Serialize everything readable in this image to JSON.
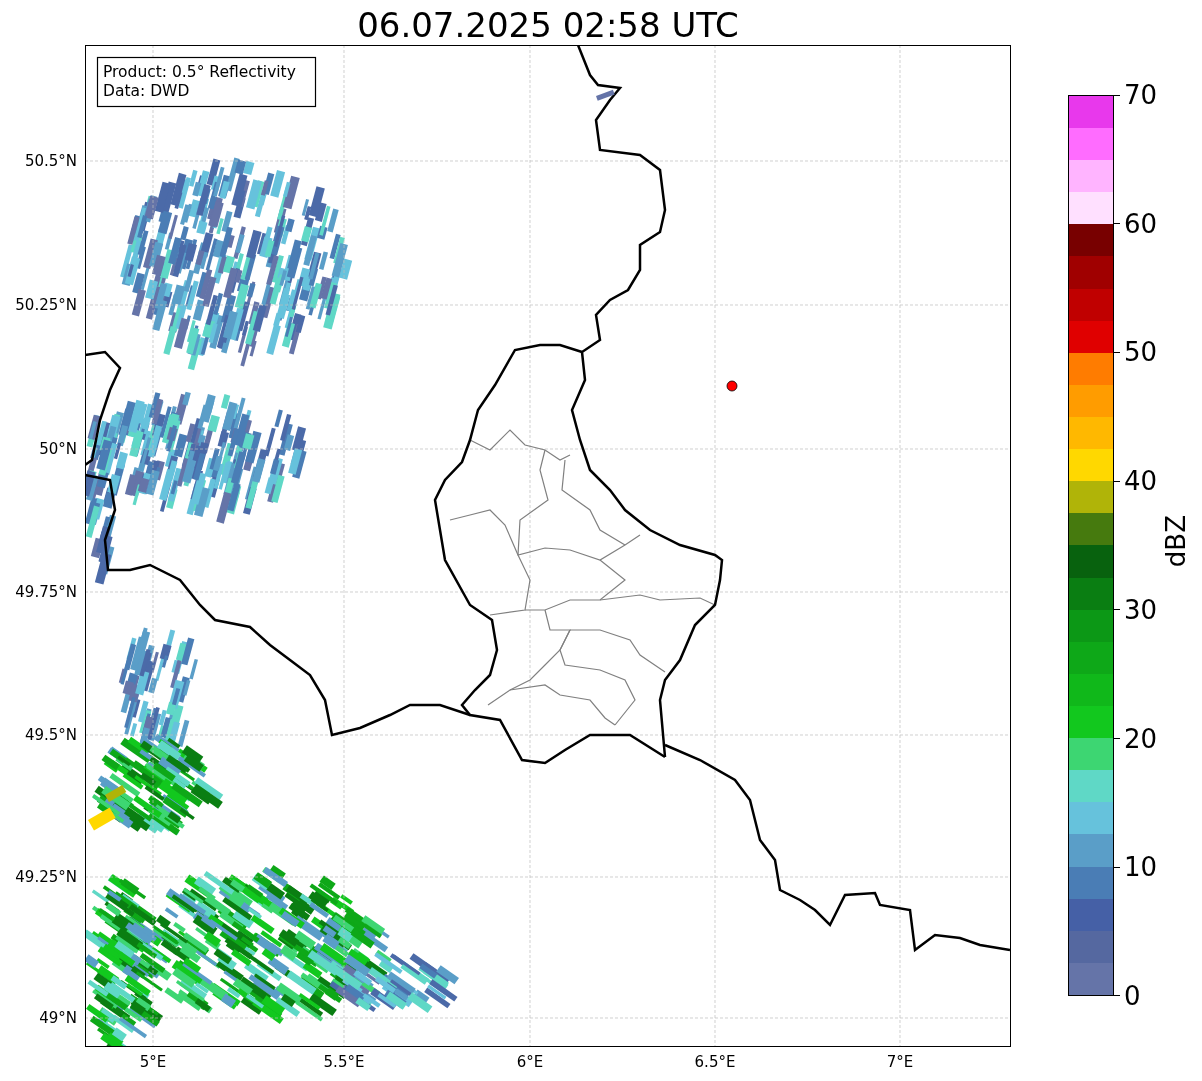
{
  "title": "06.07.2025 02:58 UTC",
  "annotation": [
    "Product: 0.5° Reflectivity",
    "Data: DWD"
  ],
  "axes": {
    "x_ticks": [
      "5°E",
      "5.5°E",
      "6°E",
      "6.5°E",
      "7°E"
    ],
    "y_ticks": [
      "50.5°N",
      "50.25°N",
      "50°N",
      "49.75°N",
      "49.5°N",
      "49.25°N",
      "49°N"
    ]
  },
  "colorbar": {
    "label": "dBZ",
    "ticks": [
      "70",
      "60",
      "50",
      "40",
      "30",
      "20",
      "10",
      "0"
    ],
    "segments": [
      {
        "color": "#6574a8"
      },
      {
        "color": "#5568a0"
      },
      {
        "color": "#4560a6"
      },
      {
        "color": "#4a7db5"
      },
      {
        "color": "#5a9ec8"
      },
      {
        "color": "#66c2dc"
      },
      {
        "color": "#5fd8c6"
      },
      {
        "color": "#3dd672"
      },
      {
        "color": "#12c81e"
      },
      {
        "color": "#10b81a"
      },
      {
        "color": "#0ea818"
      },
      {
        "color": "#0c9816"
      },
      {
        "color": "#0a7e12"
      },
      {
        "color": "#08620e"
      },
      {
        "color": "#467a0e"
      },
      {
        "color": "#b0b408"
      },
      {
        "color": "#ffd800"
      },
      {
        "color": "#ffb800"
      },
      {
        "color": "#ff9c00"
      },
      {
        "color": "#ff7c00"
      },
      {
        "color": "#e00000"
      },
      {
        "color": "#c00000"
      },
      {
        "color": "#a00000"
      },
      {
        "color": "#780000"
      },
      {
        "color": "#ffe0ff"
      },
      {
        "color": "#ffb4ff"
      },
      {
        "color": "#ff6cff"
      },
      {
        "color": "#e838ec"
      }
    ]
  }
}
